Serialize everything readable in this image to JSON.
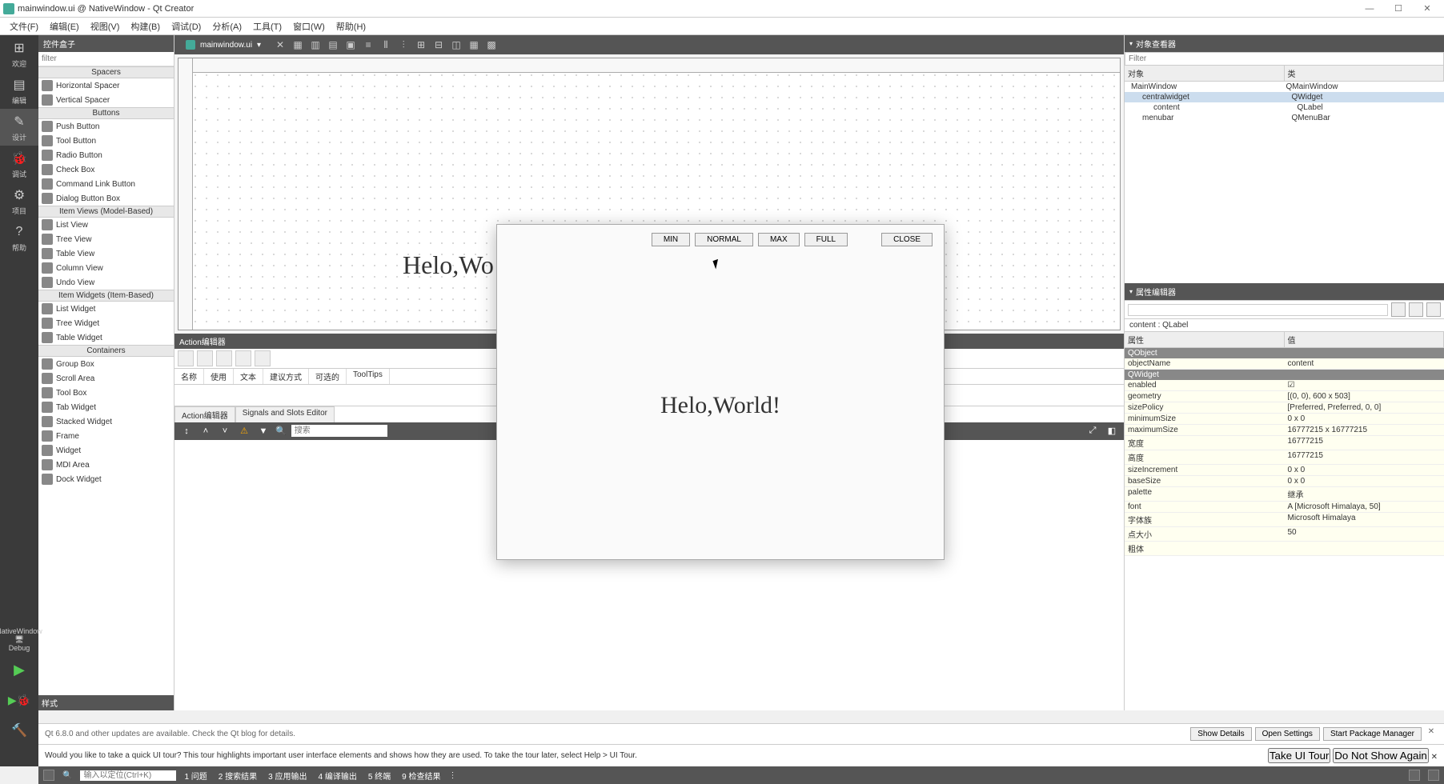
{
  "title": "mainwindow.ui @ NativeWindow - Qt Creator",
  "menus": [
    "文件(F)",
    "编辑(E)",
    "视图(V)",
    "构建(B)",
    "调试(D)",
    "分析(A)",
    "工具(T)",
    "窗口(W)",
    "帮助(H)"
  ],
  "leftstrip": [
    {
      "label": "欢迎",
      "glyph": "⊞"
    },
    {
      "label": "编辑",
      "glyph": "▤"
    },
    {
      "label": "设计",
      "glyph": "✎",
      "active": true
    },
    {
      "label": "调试",
      "glyph": "🐞"
    },
    {
      "label": "项目",
      "glyph": "⚙"
    },
    {
      "label": "帮助",
      "glyph": "?"
    }
  ],
  "widgetbox": {
    "header": "控件盒子",
    "filter_placeholder": "filter",
    "footer": "样式",
    "groups": [
      {
        "name": "Spacers",
        "items": [
          "Horizontal Spacer",
          "Vertical Spacer"
        ]
      },
      {
        "name": "Buttons",
        "items": [
          "Push Button",
          "Tool Button",
          "Radio Button",
          "Check Box",
          "Command Link Button",
          "Dialog Button Box"
        ]
      },
      {
        "name": "Item Views (Model-Based)",
        "items": [
          "List View",
          "Tree View",
          "Table View",
          "Column View",
          "Undo View"
        ]
      },
      {
        "name": "Item Widgets (Item-Based)",
        "items": [
          "List Widget",
          "Tree Widget",
          "Table Widget"
        ]
      },
      {
        "name": "Containers",
        "items": [
          "Group Box",
          "Scroll Area",
          "Tool Box",
          "Tab Widget",
          "Stacked Widget",
          "Frame",
          "Widget",
          "MDI Area",
          "Dock Widget"
        ]
      }
    ]
  },
  "doc_tab": "mainwindow.ui",
  "design_label_truncated": "Helo,Wo",
  "action_editor": {
    "header": "Action编辑器",
    "columns": [
      "名称",
      "使用",
      "文本",
      "建议方式",
      "可选的",
      "ToolTips"
    ],
    "tabs": [
      "Action编辑器",
      "Signals and Slots Editor"
    ]
  },
  "search_placeholder": "搜索",
  "object_inspector": {
    "header": "对象查看器",
    "filter_placeholder": "Filter",
    "cols": [
      "对象",
      "类"
    ],
    "rows": [
      {
        "name": "MainWindow",
        "cls": "QMainWindow",
        "indent": 0
      },
      {
        "name": "centralwidget",
        "cls": "QWidget",
        "indent": 1,
        "sel": true
      },
      {
        "name": "content",
        "cls": "QLabel",
        "indent": 2
      },
      {
        "name": "menubar",
        "cls": "QMenuBar",
        "indent": 1
      }
    ]
  },
  "property_editor": {
    "header": "属性编辑器",
    "crumb": "content : QLabel",
    "cols": [
      "属性",
      "值"
    ],
    "groups": [
      {
        "name": "QObject",
        "rows": [
          [
            "objectName",
            "content"
          ]
        ]
      },
      {
        "name": "QWidget",
        "rows": [
          [
            "enabled",
            "☑"
          ],
          [
            "geometry",
            "[(0, 0), 600 x 503]"
          ],
          [
            "sizePolicy",
            "[Preferred, Preferred, 0, 0]"
          ],
          [
            "minimumSize",
            "0 x 0"
          ],
          [
            "maximumSize",
            "16777215 x 16777215"
          ],
          [
            "宽度",
            "16777215"
          ],
          [
            "高度",
            "16777215"
          ],
          [
            "sizeIncrement",
            "0 x 0"
          ],
          [
            "baseSize",
            "0 x 0"
          ],
          [
            "palette",
            "继承"
          ],
          [
            "font",
            "A  [Microsoft Himalaya, 50]"
          ],
          [
            "字体族",
            "Microsoft Himalaya"
          ],
          [
            "点大小",
            "50"
          ],
          [
            "粗体",
            ""
          ]
        ]
      }
    ]
  },
  "preview": {
    "buttons": [
      "MIN",
      "NORMAL",
      "MAX",
      "FULL"
    ],
    "close": "CLOSE",
    "content": "Helo,World!"
  },
  "debug_target": "NativeWindow",
  "debug_mode": "Debug",
  "update_msg": "Qt 6.8.0 and other updates are available. Check the Qt blog for details.",
  "update_buttons": [
    "Show Details",
    "Open Settings",
    "Start Package Manager"
  ],
  "tour_msg": "Would you like to take a quick UI tour? This tour highlights important user interface elements and shows how they are used. To take the tour later, select Help > UI Tour.",
  "tour_buttons": [
    "Take UI Tour",
    "Do Not Show Again"
  ],
  "status": {
    "search_placeholder": "输入以定位(Ctrl+K)",
    "items": [
      "1  问题",
      "2  搜索结果",
      "3  应用输出",
      "4  编译输出",
      "5  终端",
      "9  检查结果"
    ]
  }
}
